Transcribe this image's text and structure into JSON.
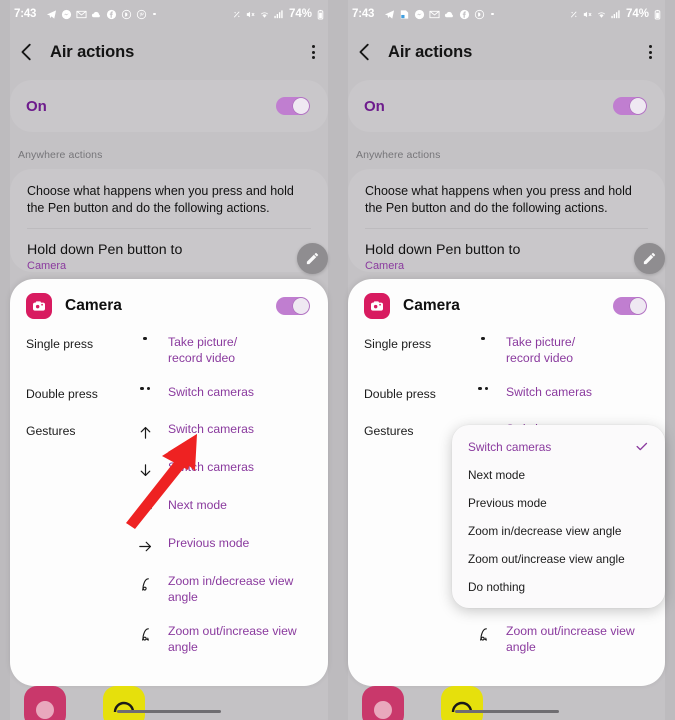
{
  "status_bar": {
    "time": "7:43",
    "battery": "74%",
    "left_icons": [
      "telegram-icon",
      "messenger-icon",
      "gmail-icon",
      "cloud-icon",
      "facebook-icon",
      "skype-icon",
      "pinterest-icon"
    ],
    "left_icons_right_panel": [
      "telegram-icon",
      "note-icon",
      "messenger-icon",
      "gmail-icon",
      "cloud-icon",
      "facebook-icon",
      "skype-icon"
    ],
    "right_icons": [
      "vibrate-icon",
      "mute-icon",
      "wifi-icon",
      "signal-icon",
      "battery-icon"
    ]
  },
  "app_bar": {
    "back_label": "back-arrow",
    "title": "Air actions",
    "overflow_label": "more-options"
  },
  "master_switch": {
    "label": "On",
    "state": "on"
  },
  "section": {
    "label": "Anywhere actions"
  },
  "description_card": {
    "text": "Choose what happens when you press and hold the Pen button and do the following actions.",
    "hold_title": "Hold down Pen button to",
    "hold_subtitle": "Camera",
    "edit_label": "edit-pencil"
  },
  "camera_sheet": {
    "app_name": "Camera",
    "app_icon": "camera-icon",
    "toggle_state": "on",
    "rows": [
      {
        "label": "Single press",
        "icon": "single-dot-icon",
        "value": "Take picture/\nrecord video"
      },
      {
        "label": "Double press",
        "icon": "double-dot-icon",
        "value": "Switch cameras"
      },
      {
        "label": "Gestures",
        "icon": "arrow-up-icon",
        "value": "Switch cameras"
      },
      {
        "label": "",
        "icon": "arrow-down-icon",
        "value": "Switch cameras"
      },
      {
        "label": "",
        "icon": "arrow-left-icon",
        "value": "Next mode"
      },
      {
        "label": "",
        "icon": "arrow-right-icon",
        "value": "Previous mode"
      },
      {
        "label": "",
        "icon": "swirl-in-icon",
        "value": "Zoom in/decrease view angle"
      },
      {
        "label": "",
        "icon": "swirl-out-icon",
        "value": "Zoom out/increase view angle"
      }
    ]
  },
  "dropdown": {
    "items": [
      {
        "label": "Switch cameras",
        "selected": true
      },
      {
        "label": "Next mode",
        "selected": false
      },
      {
        "label": "Previous mode",
        "selected": false
      },
      {
        "label": "Zoom in/decrease view angle",
        "selected": false
      },
      {
        "label": "Zoom out/increase view angle",
        "selected": false
      },
      {
        "label": "Do nothing",
        "selected": false
      }
    ],
    "check_icon": "checkmark-icon"
  },
  "colors": {
    "accent_purple": "#8a3a9e",
    "master_purple": "#6d1b8c",
    "toggle_purple": "#c07ed0",
    "camera_crimson": "#d81b60",
    "annotation_red": "#ee2222",
    "background_gray": "#c4c2c5",
    "sheet_white": "#fdfdfd"
  },
  "annotation": {
    "arrow_label": "red-pointer-arrow",
    "points_to": "Switch cameras"
  },
  "dock": {
    "icons": [
      "pink-app-icon",
      "yellow-app-icon"
    ],
    "nav_label": "gesture-nav-bar"
  }
}
